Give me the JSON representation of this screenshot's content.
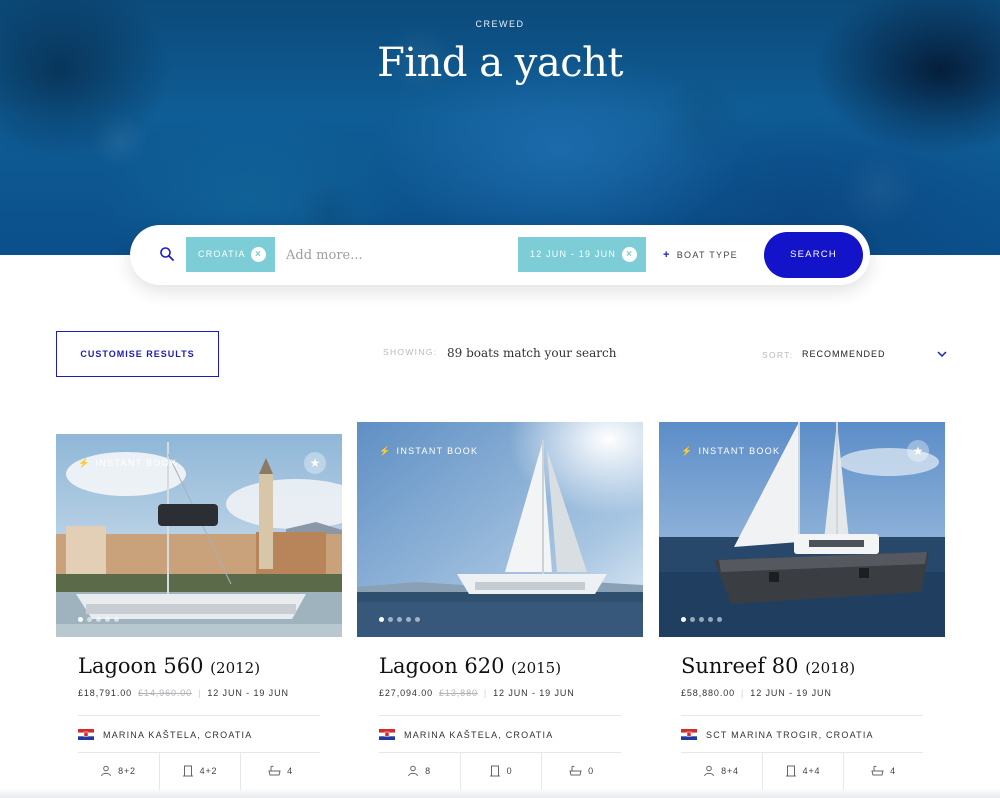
{
  "hero": {
    "brand": "CREWED",
    "title": "Find a yacht"
  },
  "search": {
    "chips": [
      {
        "label": "CROATIA"
      },
      {
        "label": "12 JUN - 19 JUN"
      }
    ],
    "chip_remove_symbol": "×",
    "add_more_placeholder": "Add more...",
    "boat_type_label": "BOAT TYPE",
    "boat_type_symbol": "+",
    "submit_label": "SEARCH",
    "accent_color": "#1313c9",
    "chip_color": "#7ccdd6"
  },
  "results": {
    "customise_label": "CUSTOMISE RESULTS",
    "showing_label": "SHOWING:",
    "match_text": "89 boats match your search",
    "sort_label": "SORT:",
    "sort_value": "RECOMMENDED"
  },
  "cards": [
    {
      "badge": "INSTANT BOOK",
      "name": "Lagoon 560",
      "year": "(2012)",
      "price": "£18,791.00",
      "old_price": "£14,960.00",
      "dates": "12 JUN - 19 JUN",
      "location": "MARINA KAŠTELA, CROATIA",
      "specs": {
        "guests": "8+2",
        "cabins": "4+2",
        "bathrooms": "4"
      },
      "carousel_dots": 5,
      "active_dot": 0
    },
    {
      "badge": "INSTANT BOOK",
      "name": "Lagoon 620",
      "year": "(2015)",
      "price": "£27,094.00",
      "old_price": "£13,880",
      "dates": "12 JUN - 19 JUN",
      "location": "MARINA KAŠTELA, CROATIA",
      "specs": {
        "guests": "8",
        "cabins": "0",
        "bathrooms": "0"
      },
      "carousel_dots": 5,
      "active_dot": 0
    },
    {
      "badge": "INSTANT BOOK",
      "name": "Sunreef 80",
      "year": "(2018)",
      "price": "£58,880.00",
      "old_price": "",
      "dates": "12 JUN - 19 JUN",
      "location": "SCT MARINA TROGIR, CROATIA",
      "specs": {
        "guests": "8+4",
        "cabins": "4+4",
        "bathrooms": "4"
      },
      "carousel_dots": 5,
      "active_dot": 0
    }
  ],
  "icons": {
    "search": "search-icon",
    "favourite": "star-icon",
    "instant": "bolt-icon",
    "guests": "person-icon",
    "cabins": "door-icon",
    "bathrooms": "bathtub-icon",
    "flag": "croatia-flag-icon",
    "sort": "chevron-down-icon"
  }
}
